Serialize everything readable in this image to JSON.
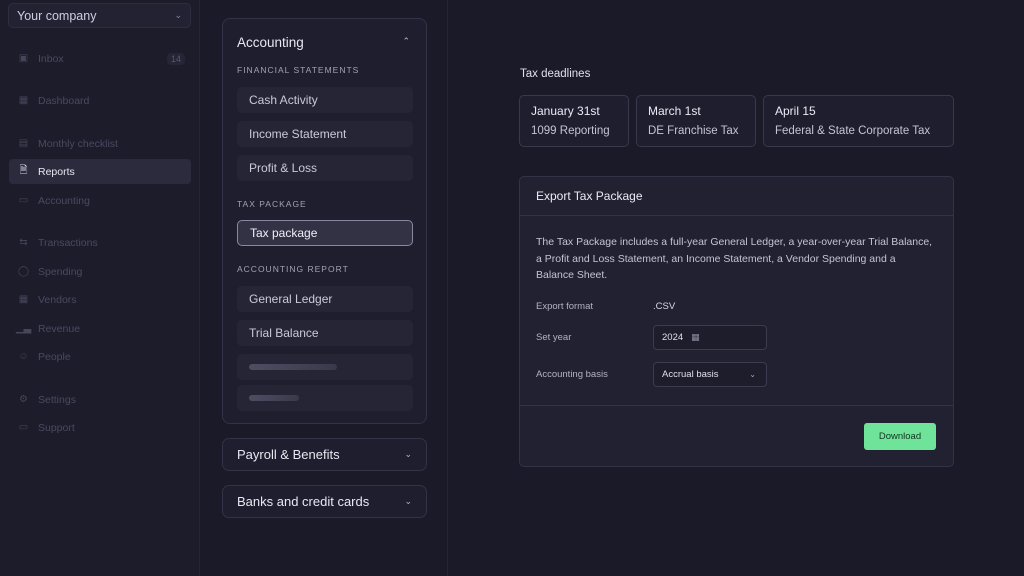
{
  "sidebar": {
    "company": "Your company",
    "items": [
      {
        "label": "Inbox",
        "icon": "inbox-icon",
        "badge": "14"
      },
      {
        "label": "Dashboard",
        "icon": "dashboard-icon"
      },
      {
        "label": "Monthly checklist",
        "icon": "checklist-icon"
      },
      {
        "label": "Reports",
        "icon": "reports-icon",
        "active": true
      },
      {
        "label": "Accounting",
        "icon": "folder-icon"
      },
      {
        "label": "Transactions",
        "icon": "transactions-icon"
      },
      {
        "label": "Spending",
        "icon": "spending-icon"
      },
      {
        "label": "Vendors",
        "icon": "vendors-icon"
      },
      {
        "label": "Revenue",
        "icon": "revenue-icon"
      },
      {
        "label": "People",
        "icon": "people-icon"
      },
      {
        "label": "Settings",
        "icon": "settings-icon"
      },
      {
        "label": "Support",
        "icon": "support-icon"
      }
    ]
  },
  "accounting": {
    "title": "Accounting",
    "financial_label": "FINANCIAL STATEMENTS",
    "financial_items": [
      "Cash Activity",
      "Income Statement",
      "Profit & Loss"
    ],
    "tax_label": "TAX PACKAGE",
    "tax_items": [
      "Tax package"
    ],
    "report_label": "ACCOUNTING REPORT",
    "report_items": [
      "General Ledger",
      "Trial Balance"
    ]
  },
  "payroll": {
    "title": "Payroll & Benefits"
  },
  "banks": {
    "title": "Banks and credit cards"
  },
  "deadlines": {
    "title": "Tax deadlines",
    "items": [
      {
        "date": "January 31st",
        "desc": "1099 Reporting"
      },
      {
        "date": "March 1st",
        "desc": "DE Franchise Tax"
      },
      {
        "date": "April 15",
        "desc": "Federal & State Corporate Tax"
      }
    ]
  },
  "export": {
    "title": "Export Tax Package",
    "description": "The Tax Package includes a full-year General Ledger, a year-over-year Trial Balance, a Profit and Loss Statement, an Income Statement, a Vendor Spending and a Balance Sheet.",
    "format_label": "Export format",
    "format_value": ".CSV",
    "year_label": "Set year",
    "year_value": "2024",
    "basis_label": "Accounting basis",
    "basis_value": "Accrual basis",
    "download_label": "Download"
  },
  "colors": {
    "accent": "#70e39a",
    "background": "#1b1a29"
  }
}
